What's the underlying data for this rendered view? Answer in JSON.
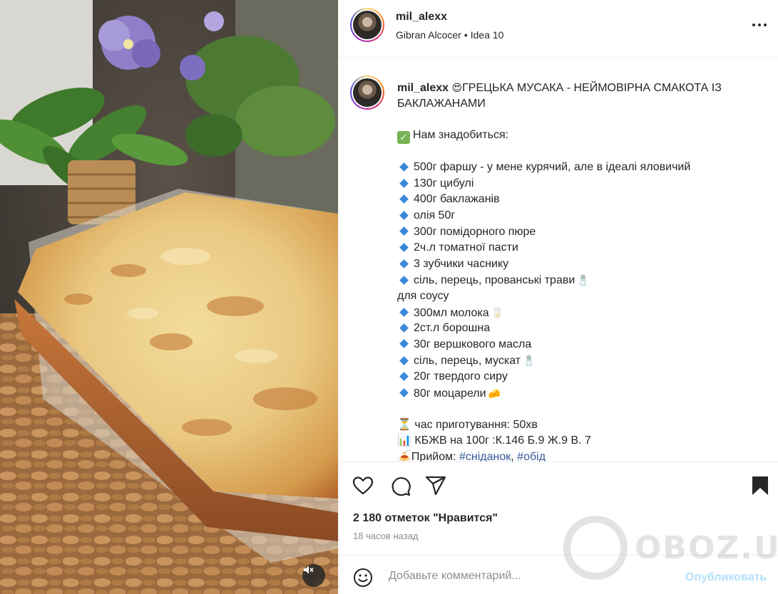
{
  "post": {
    "username": "mil_alexx",
    "audio_artist": "Gibran Alcocer",
    "audio_track": "Idea 10",
    "separator": "•"
  },
  "caption": {
    "username": "mil_alexx",
    "title": "ГРЕЦЬКА МУСАКА - НЕЙМОВІРНА СМАКОТА ІЗ БАКЛАЖАНАМИ",
    "title_emoji": "😍",
    "need_heading": "Нам знадобиться:",
    "ingredients": [
      "500г фаршу - у мене курячий, але в ідеалі яловичий",
      "130г цибулі",
      "400г баклажанів",
      "олія 50г",
      "300г помідорного пюре",
      "2ч.л томатної пасти",
      "3 зубчики часнику",
      "сіль, перець, прованські трави"
    ],
    "salt_emoji": "🧂",
    "sauce_heading": "для соусу",
    "sauce_ingredients": [
      "300мл молока",
      "2ст.л борошна",
      "30г вершкового масла",
      "сіль, перець, мускат",
      "20г твердого сиру",
      "80г моцарели"
    ],
    "milk_emoji": "🥛",
    "cheese_emoji": "🧀",
    "cook_time_emoji": "⏳",
    "cook_time": "час приготування: 50хв",
    "nutrition_emoji": "📊",
    "nutrition": "КБЖВ на 100г :К.146 Б.9 Ж.9 В. 7",
    "meal_emoji": "🍝",
    "meal_label": "Прийом:",
    "tags": [
      "#сніданок",
      "#обід"
    ],
    "tag_separator": ","
  },
  "engagement": {
    "likes": "2 180 отметок \"Нравится\"",
    "time_ago": "18 часов назад"
  },
  "comment": {
    "placeholder": "Добавьте комментарий...",
    "publish_label": "Опубликовать"
  },
  "watermark": "OBOZ.UA",
  "colors": {
    "text": "#262626",
    "secondary": "#8e8e8e",
    "link": "#385898",
    "publish_disabled": "#b2dffc",
    "divider": "#efefef"
  },
  "icons": {
    "more": "more-options-icon",
    "like": "heart-icon",
    "comment": "comment-icon",
    "share": "share-icon",
    "save": "bookmark-icon",
    "emoji": "emoji-icon",
    "mute": "muted-speaker-icon"
  }
}
